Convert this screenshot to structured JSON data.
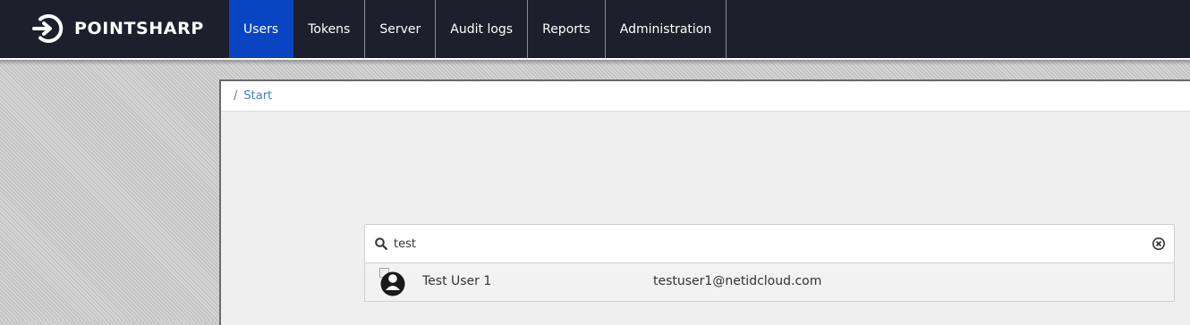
{
  "header": {
    "logo_text": "POINTSHARP",
    "nav": [
      {
        "label": "Users",
        "active": true
      },
      {
        "label": "Tokens"
      },
      {
        "label": "Server"
      },
      {
        "label": "Audit logs"
      },
      {
        "label": "Reports"
      },
      {
        "label": "Administration"
      }
    ]
  },
  "breadcrumb": {
    "separator": "/",
    "items": [
      "Start"
    ]
  },
  "search": {
    "value": "test",
    "icon": "search-icon",
    "clear_icon": "clear-icon"
  },
  "results": [
    {
      "name": "Test User 1",
      "email": "testuser1@netidcloud.com",
      "icon": "user-avatar-icon"
    }
  ],
  "colors": {
    "topbar": "#1d1f2c",
    "active_tab": "#0944c2",
    "link": "#4a7ec0"
  }
}
